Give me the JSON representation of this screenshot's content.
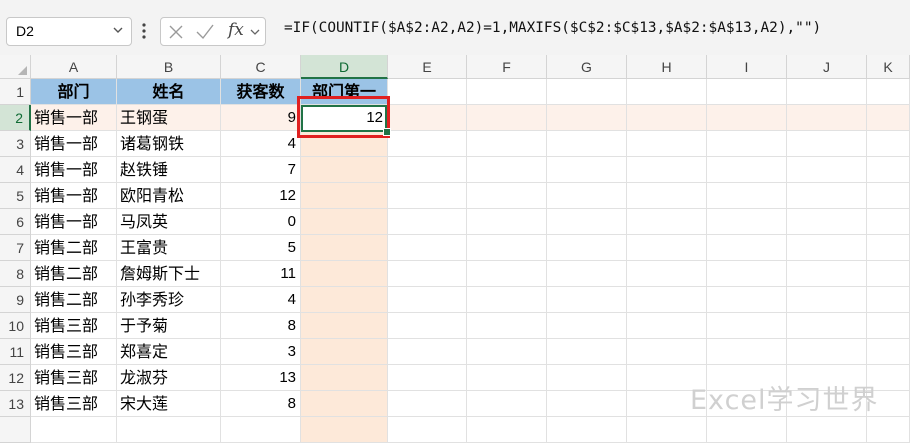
{
  "formula_bar": {
    "name_box": "D2",
    "fx_label": "fx",
    "formula": "=IF(COUNTIF($A$2:A2,A2)=1,MAXIFS($C$2:$C$13,$A$2:$A$13,A2),\"\")"
  },
  "grid": {
    "columns": [
      "A",
      "B",
      "C",
      "D",
      "E",
      "F",
      "G",
      "H",
      "I",
      "J",
      "K"
    ],
    "rows": [
      "1",
      "2",
      "3",
      "4",
      "5",
      "6",
      "7",
      "8",
      "9",
      "10",
      "11",
      "12",
      "13"
    ],
    "selected_cell": "D2",
    "headers": {
      "A": "部门",
      "B": "姓名",
      "C": "获客数",
      "D": "部门第一"
    },
    "data": [
      {
        "dept": "销售一部",
        "name": "王钢蛋",
        "count": "9",
        "first": "12"
      },
      {
        "dept": "销售一部",
        "name": "诸葛钢铁",
        "count": "4",
        "first": ""
      },
      {
        "dept": "销售一部",
        "name": "赵铁锤",
        "count": "7",
        "first": ""
      },
      {
        "dept": "销售一部",
        "name": "欧阳青松",
        "count": "12",
        "first": ""
      },
      {
        "dept": "销售一部",
        "name": "马凤英",
        "count": "0",
        "first": ""
      },
      {
        "dept": "销售二部",
        "name": "王富贵",
        "count": "5",
        "first": ""
      },
      {
        "dept": "销售二部",
        "name": "詹姆斯下士",
        "count": "11",
        "first": ""
      },
      {
        "dept": "销售二部",
        "name": "孙李秀珍",
        "count": "4",
        "first": ""
      },
      {
        "dept": "销售三部",
        "name": "于予菊",
        "count": "8",
        "first": ""
      },
      {
        "dept": "销售三部",
        "name": "郑喜定",
        "count": "3",
        "first": ""
      },
      {
        "dept": "销售三部",
        "name": "龙淑芬",
        "count": "13",
        "first": ""
      },
      {
        "dept": "销售三部",
        "name": "宋大莲",
        "count": "8",
        "first": ""
      }
    ]
  },
  "watermark": "Excel学习世界",
  "colors": {
    "header_fill": "#9bc3e6",
    "highlight_fill": "#fde9d9",
    "selection_green": "#217346",
    "annotation_red": "#e02020"
  }
}
